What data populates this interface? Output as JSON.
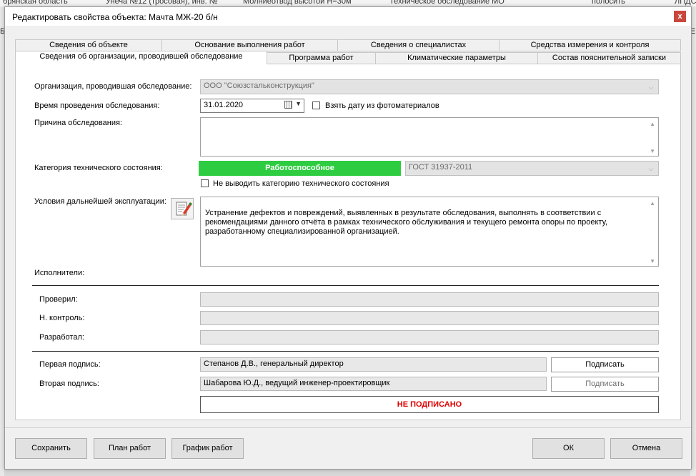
{
  "background": {
    "col1": "брянская область",
    "col2": "Унеча  №12 (тросовая), инв. №",
    "col3": "Молниеотвод высотой Н=30м",
    "col4": "Техническое обследование МО",
    "col5": "полосить",
    "col6": "ЛПДС",
    "left_char": "Б",
    "right_char": "Е"
  },
  "dialog": {
    "title": "Редактировать свойства объекта: Мачта МЖ-20 б/н",
    "close_glyph": "x"
  },
  "tabs": {
    "row1": [
      "Сведения об объекте",
      "Основание выполнения работ",
      "Сведения о специалистах",
      "Средства измерения и контроля"
    ],
    "row2": [
      "Сведения об организации, проводившей обследование",
      "Программа работ",
      "Климатические параметры",
      "Состав пояснительной записки"
    ]
  },
  "form": {
    "org_label": "Организация, проводившая обследование:",
    "org_value": "ООО \"Союзстальконструкция\"",
    "date_label": "Время проведения обследования:",
    "date_value": "31.01.2020",
    "photo_date_label": "Взять дату из фотоматериалов",
    "reason_label": "Причина обследования:",
    "reason_value": "",
    "category_label": "Категория технического состояния:",
    "category_value": "Работоспособное",
    "category_color": "#2ecc40",
    "standard_value": "ГОСТ 31937-2011",
    "hide_category_label": "Не выводить категорию технического состояния",
    "conditions_label": "Условия дальнейшей эксплуатации:",
    "conditions_value": "Устранение дефектов и повреждений, выявленных в результате обследования, выполнять в соответствии с рекомендациями данного отчёта в рамках технического обслуживания и текущего ремонта опоры по проекту, разработанному специализированной организацией.",
    "performers_label": "Исполнители:",
    "checked_label": "Проверил:",
    "checked_value": "",
    "norm_control_label": "Н. контроль:",
    "norm_control_value": "",
    "developed_label": "Разработал:",
    "developed_value": "",
    "first_sign_label": "Первая подпись:",
    "first_sign_value": "Степанов Д.В., генеральный директор",
    "first_sign_button": "Подписать",
    "second_sign_label": "Вторая подпись:",
    "second_sign_value": "Шабарова Ю.Д., ведущий инженер-проектировщик",
    "second_sign_button": "Подписать",
    "status_text": "НЕ ПОДПИСАНО",
    "status_color": "#e00000"
  },
  "footer": {
    "save": "Сохранить",
    "work_plan": "План работ",
    "schedule": "График работ",
    "ok": "ОК",
    "cancel": "Отмена"
  }
}
